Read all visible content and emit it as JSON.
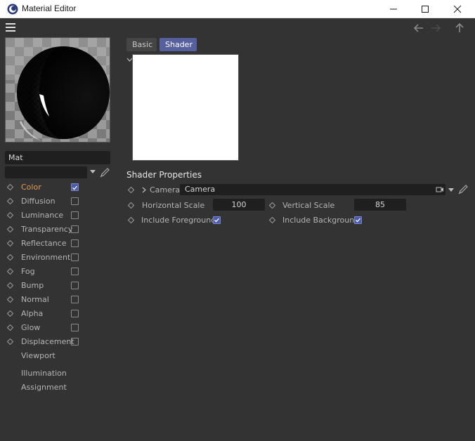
{
  "window": {
    "title": "Material Editor",
    "icon": "cinema4d-logo-icon"
  },
  "toolbar": {
    "menu_icon": "hamburger-menu-icon",
    "nav": [
      "arrow-left-icon",
      "arrow-right-icon",
      "arrow-up-icon"
    ]
  },
  "material": {
    "name": "Mat",
    "layer_value": ""
  },
  "channels": [
    {
      "label": "Color",
      "checked": true,
      "active": true
    },
    {
      "label": "Diffusion",
      "checked": false,
      "active": false
    },
    {
      "label": "Luminance",
      "checked": false,
      "active": false
    },
    {
      "label": "Transparency",
      "checked": false,
      "active": false
    },
    {
      "label": "Reflectance",
      "checked": false,
      "active": false
    },
    {
      "label": "Environment",
      "checked": false,
      "active": false
    },
    {
      "label": "Fog",
      "checked": false,
      "active": false
    },
    {
      "label": "Bump",
      "checked": false,
      "active": false
    },
    {
      "label": "Normal",
      "checked": false,
      "active": false
    },
    {
      "label": "Alpha",
      "checked": false,
      "active": false
    },
    {
      "label": "Glow",
      "checked": false,
      "active": false
    },
    {
      "label": "Displacement",
      "checked": false,
      "active": false
    }
  ],
  "extra_items": [
    "Viewport",
    "Illumination",
    "Assignment"
  ],
  "tabs": {
    "basic": "Basic",
    "shader": "Shader",
    "active": "Shader"
  },
  "shader_properties": {
    "title": "Shader Properties",
    "camera_label": "Camera",
    "camera_value": "Camera",
    "horizontal_scale_label": "Horizontal Scale",
    "horizontal_scale_value": "100",
    "vertical_scale_label": "Vertical Scale",
    "vertical_scale_value": "85",
    "include_foreground_label": "Include Foreground",
    "include_foreground": true,
    "include_background_label": "Include Background",
    "include_background": true
  },
  "colors": {
    "background": "#333333",
    "accent": "#56609f",
    "active_channel": "#e39a52",
    "field": "#1f1f1f"
  }
}
